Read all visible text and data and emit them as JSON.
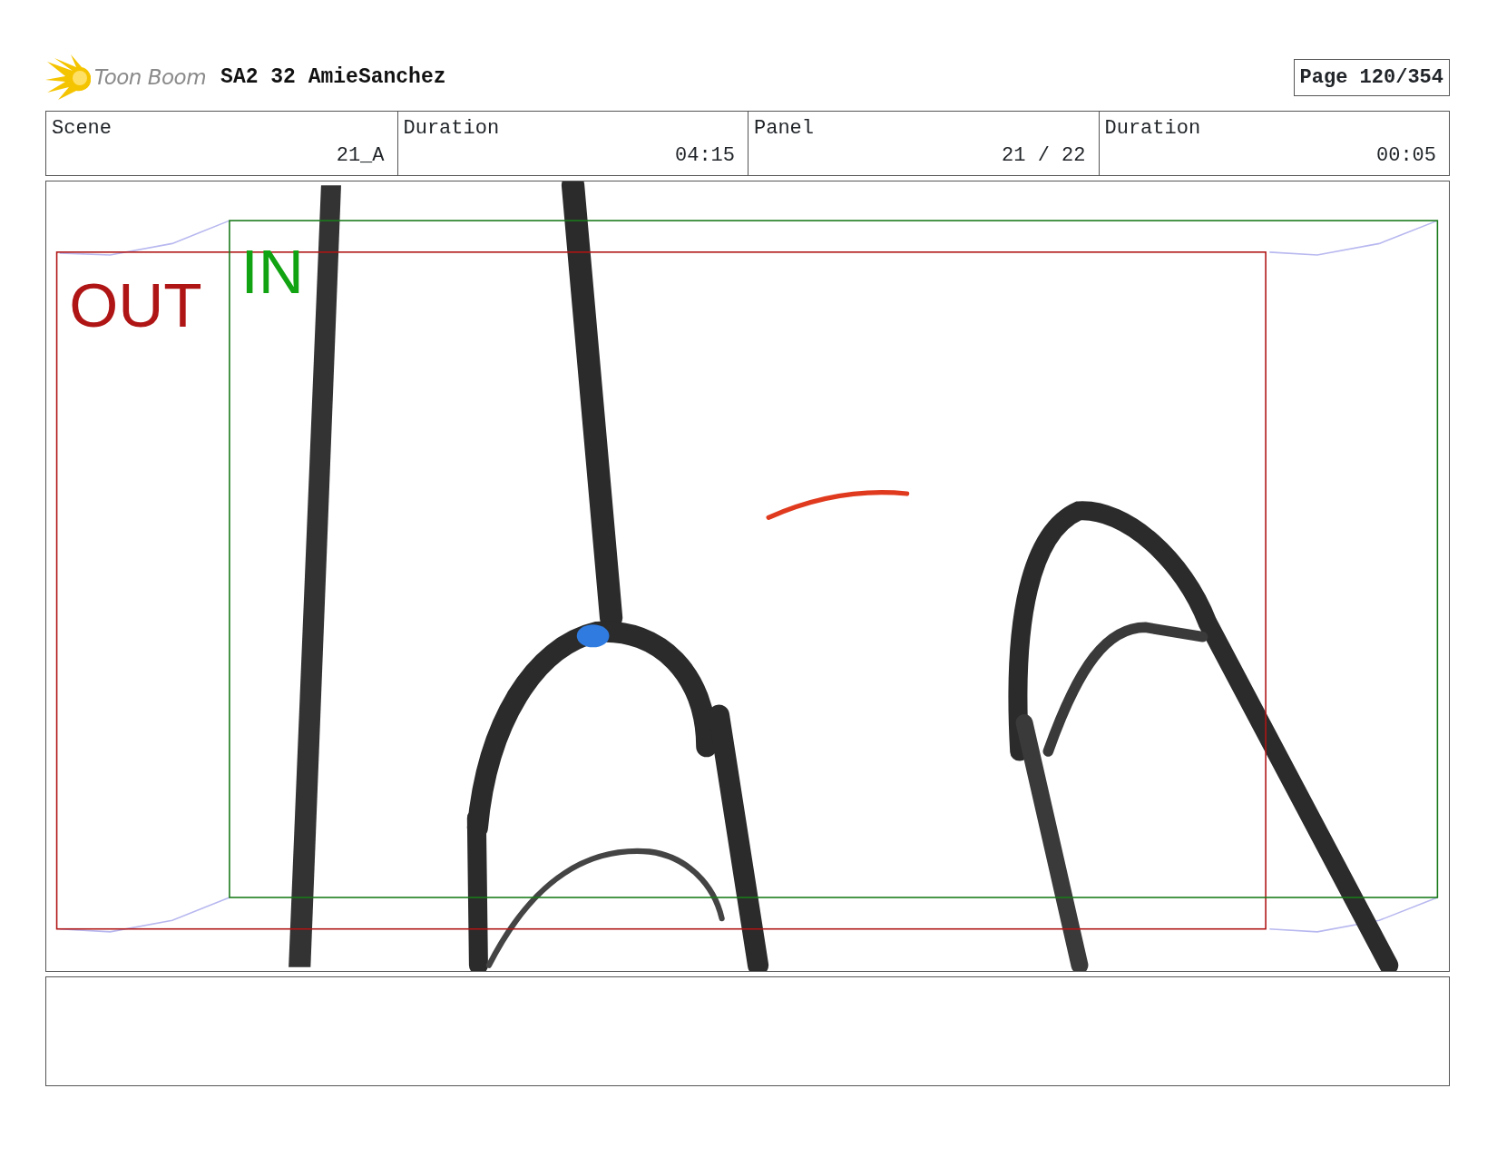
{
  "header": {
    "logo_text": "Toon Boom",
    "title": "SA2 32 AmieSanchez",
    "page": "Page 120/354"
  },
  "info": [
    {
      "label": "Scene",
      "value": "21_A"
    },
    {
      "label": "Duration",
      "value": "04:15"
    },
    {
      "label": "Panel",
      "value": "21 / 22"
    },
    {
      "label": "Duration",
      "value": "00:05"
    }
  ],
  "panel": {
    "frames": [
      {
        "kind": "out",
        "label": "OUT"
      },
      {
        "kind": "in",
        "label": "IN"
      }
    ]
  }
}
